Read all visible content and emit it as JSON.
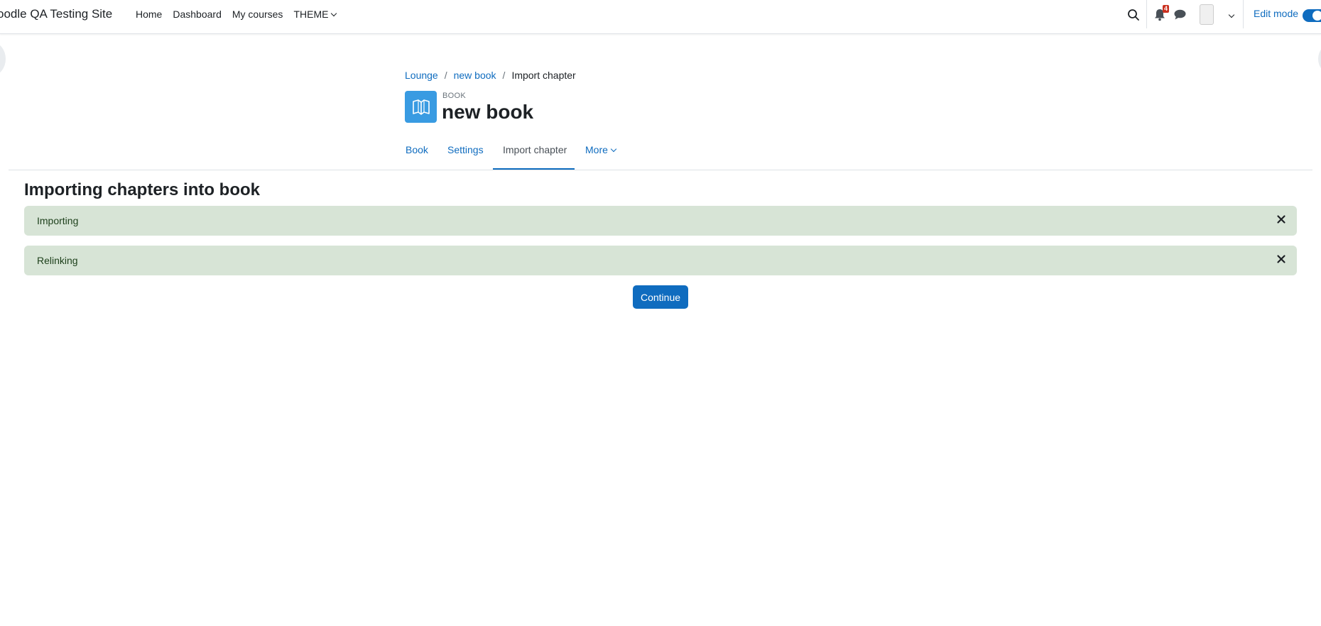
{
  "navbar": {
    "brand": "oodle QA Testing Site",
    "links": [
      "Home",
      "Dashboard",
      "My courses",
      "THEME"
    ],
    "notification_count": "4",
    "edit_mode_label": "Edit mode"
  },
  "breadcrumb": {
    "items": [
      "Lounge",
      "new book",
      "Import chapter"
    ],
    "separator": "/"
  },
  "header": {
    "activity_type": "BOOK",
    "title": "new book"
  },
  "secondary_nav": {
    "tabs": [
      "Book",
      "Settings",
      "Import chapter",
      "More"
    ],
    "active": "Import chapter"
  },
  "main": {
    "heading": "Importing chapters into book",
    "alerts": [
      "Importing",
      "Relinking"
    ],
    "continue_label": "Continue"
  },
  "colors": {
    "primary": "#0f6cbf",
    "activity_icon_bg": "#399be2",
    "alert_success_bg": "#d7e4d6",
    "badge": "#ca3120"
  },
  "icons": {
    "search": "search-icon",
    "notifications": "bell-icon",
    "messages": "chat-icon",
    "activity": "book-icon",
    "close": "close-icon"
  }
}
